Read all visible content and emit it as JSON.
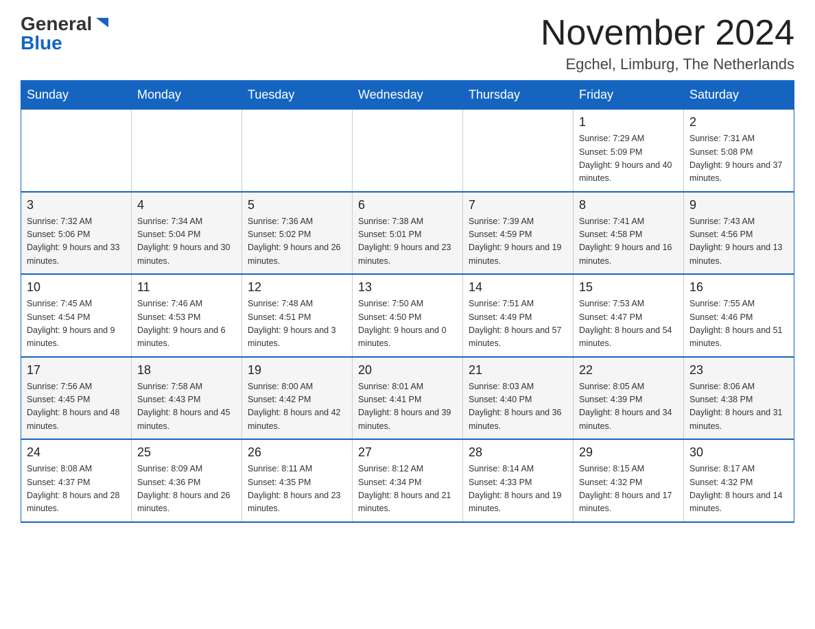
{
  "logo": {
    "general": "General",
    "blue": "Blue",
    "triangle": "▶"
  },
  "title": "November 2024",
  "location": "Egchel, Limburg, The Netherlands",
  "days_of_week": [
    "Sunday",
    "Monday",
    "Tuesday",
    "Wednesday",
    "Thursday",
    "Friday",
    "Saturday"
  ],
  "weeks": [
    [
      {
        "day": "",
        "info": ""
      },
      {
        "day": "",
        "info": ""
      },
      {
        "day": "",
        "info": ""
      },
      {
        "day": "",
        "info": ""
      },
      {
        "day": "",
        "info": ""
      },
      {
        "day": "1",
        "info": "Sunrise: 7:29 AM\nSunset: 5:09 PM\nDaylight: 9 hours and 40 minutes."
      },
      {
        "day": "2",
        "info": "Sunrise: 7:31 AM\nSunset: 5:08 PM\nDaylight: 9 hours and 37 minutes."
      }
    ],
    [
      {
        "day": "3",
        "info": "Sunrise: 7:32 AM\nSunset: 5:06 PM\nDaylight: 9 hours and 33 minutes."
      },
      {
        "day": "4",
        "info": "Sunrise: 7:34 AM\nSunset: 5:04 PM\nDaylight: 9 hours and 30 minutes."
      },
      {
        "day": "5",
        "info": "Sunrise: 7:36 AM\nSunset: 5:02 PM\nDaylight: 9 hours and 26 minutes."
      },
      {
        "day": "6",
        "info": "Sunrise: 7:38 AM\nSunset: 5:01 PM\nDaylight: 9 hours and 23 minutes."
      },
      {
        "day": "7",
        "info": "Sunrise: 7:39 AM\nSunset: 4:59 PM\nDaylight: 9 hours and 19 minutes."
      },
      {
        "day": "8",
        "info": "Sunrise: 7:41 AM\nSunset: 4:58 PM\nDaylight: 9 hours and 16 minutes."
      },
      {
        "day": "9",
        "info": "Sunrise: 7:43 AM\nSunset: 4:56 PM\nDaylight: 9 hours and 13 minutes."
      }
    ],
    [
      {
        "day": "10",
        "info": "Sunrise: 7:45 AM\nSunset: 4:54 PM\nDaylight: 9 hours and 9 minutes."
      },
      {
        "day": "11",
        "info": "Sunrise: 7:46 AM\nSunset: 4:53 PM\nDaylight: 9 hours and 6 minutes."
      },
      {
        "day": "12",
        "info": "Sunrise: 7:48 AM\nSunset: 4:51 PM\nDaylight: 9 hours and 3 minutes."
      },
      {
        "day": "13",
        "info": "Sunrise: 7:50 AM\nSunset: 4:50 PM\nDaylight: 9 hours and 0 minutes."
      },
      {
        "day": "14",
        "info": "Sunrise: 7:51 AM\nSunset: 4:49 PM\nDaylight: 8 hours and 57 minutes."
      },
      {
        "day": "15",
        "info": "Sunrise: 7:53 AM\nSunset: 4:47 PM\nDaylight: 8 hours and 54 minutes."
      },
      {
        "day": "16",
        "info": "Sunrise: 7:55 AM\nSunset: 4:46 PM\nDaylight: 8 hours and 51 minutes."
      }
    ],
    [
      {
        "day": "17",
        "info": "Sunrise: 7:56 AM\nSunset: 4:45 PM\nDaylight: 8 hours and 48 minutes."
      },
      {
        "day": "18",
        "info": "Sunrise: 7:58 AM\nSunset: 4:43 PM\nDaylight: 8 hours and 45 minutes."
      },
      {
        "day": "19",
        "info": "Sunrise: 8:00 AM\nSunset: 4:42 PM\nDaylight: 8 hours and 42 minutes."
      },
      {
        "day": "20",
        "info": "Sunrise: 8:01 AM\nSunset: 4:41 PM\nDaylight: 8 hours and 39 minutes."
      },
      {
        "day": "21",
        "info": "Sunrise: 8:03 AM\nSunset: 4:40 PM\nDaylight: 8 hours and 36 minutes."
      },
      {
        "day": "22",
        "info": "Sunrise: 8:05 AM\nSunset: 4:39 PM\nDaylight: 8 hours and 34 minutes."
      },
      {
        "day": "23",
        "info": "Sunrise: 8:06 AM\nSunset: 4:38 PM\nDaylight: 8 hours and 31 minutes."
      }
    ],
    [
      {
        "day": "24",
        "info": "Sunrise: 8:08 AM\nSunset: 4:37 PM\nDaylight: 8 hours and 28 minutes."
      },
      {
        "day": "25",
        "info": "Sunrise: 8:09 AM\nSunset: 4:36 PM\nDaylight: 8 hours and 26 minutes."
      },
      {
        "day": "26",
        "info": "Sunrise: 8:11 AM\nSunset: 4:35 PM\nDaylight: 8 hours and 23 minutes."
      },
      {
        "day": "27",
        "info": "Sunrise: 8:12 AM\nSunset: 4:34 PM\nDaylight: 8 hours and 21 minutes."
      },
      {
        "day": "28",
        "info": "Sunrise: 8:14 AM\nSunset: 4:33 PM\nDaylight: 8 hours and 19 minutes."
      },
      {
        "day": "29",
        "info": "Sunrise: 8:15 AM\nSunset: 4:32 PM\nDaylight: 8 hours and 17 minutes."
      },
      {
        "day": "30",
        "info": "Sunrise: 8:17 AM\nSunset: 4:32 PM\nDaylight: 8 hours and 14 minutes."
      }
    ]
  ],
  "colors": {
    "header_bg": "#1565c0",
    "header_text": "#ffffff",
    "border": "#1565c0",
    "text_dark": "#222222",
    "text_body": "#333333"
  }
}
